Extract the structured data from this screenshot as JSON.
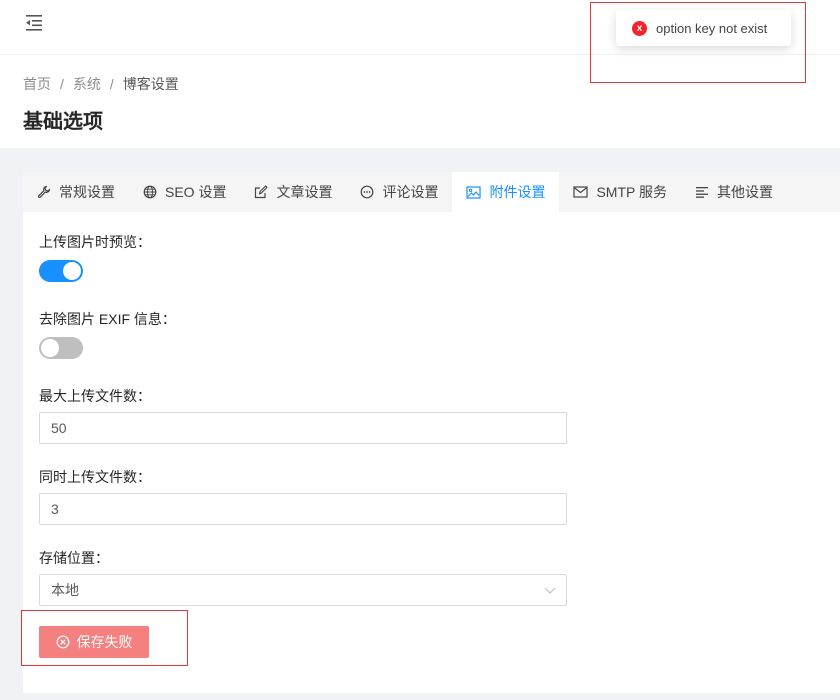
{
  "breadcrumb": {
    "home": "首页",
    "system": "系统",
    "current": "博客设置",
    "separator": "/"
  },
  "page_title": "基础选项",
  "tabs": [
    {
      "label": "常规设置",
      "icon": "wrench-icon"
    },
    {
      "label": "SEO 设置",
      "icon": "globe-icon"
    },
    {
      "label": "文章设置",
      "icon": "edit-icon"
    },
    {
      "label": "评论设置",
      "icon": "comment-icon"
    },
    {
      "label": "附件设置",
      "icon": "picture-icon",
      "active": true
    },
    {
      "label": "SMTP 服务",
      "icon": "mail-icon"
    },
    {
      "label": "其他设置",
      "icon": "align-left-icon"
    }
  ],
  "form": {
    "preview_label": "上传图片时预览：",
    "preview_enabled": true,
    "exif_label": "去除图片 EXIF 信息：",
    "exif_enabled": false,
    "max_files_label": "最大上传文件数：",
    "max_files_value": "50",
    "concurrent_label": "同时上传文件数：",
    "concurrent_value": "3",
    "storage_label": "存储位置：",
    "storage_value": "本地"
  },
  "save_button": {
    "label": "保存失败"
  },
  "toast": {
    "message": "option key not exist",
    "icon_glyph": "x"
  },
  "colors": {
    "primary": "#1890ff",
    "error": "#f5222d",
    "danger_button": "#f4817f",
    "highlight": "#e53935"
  }
}
